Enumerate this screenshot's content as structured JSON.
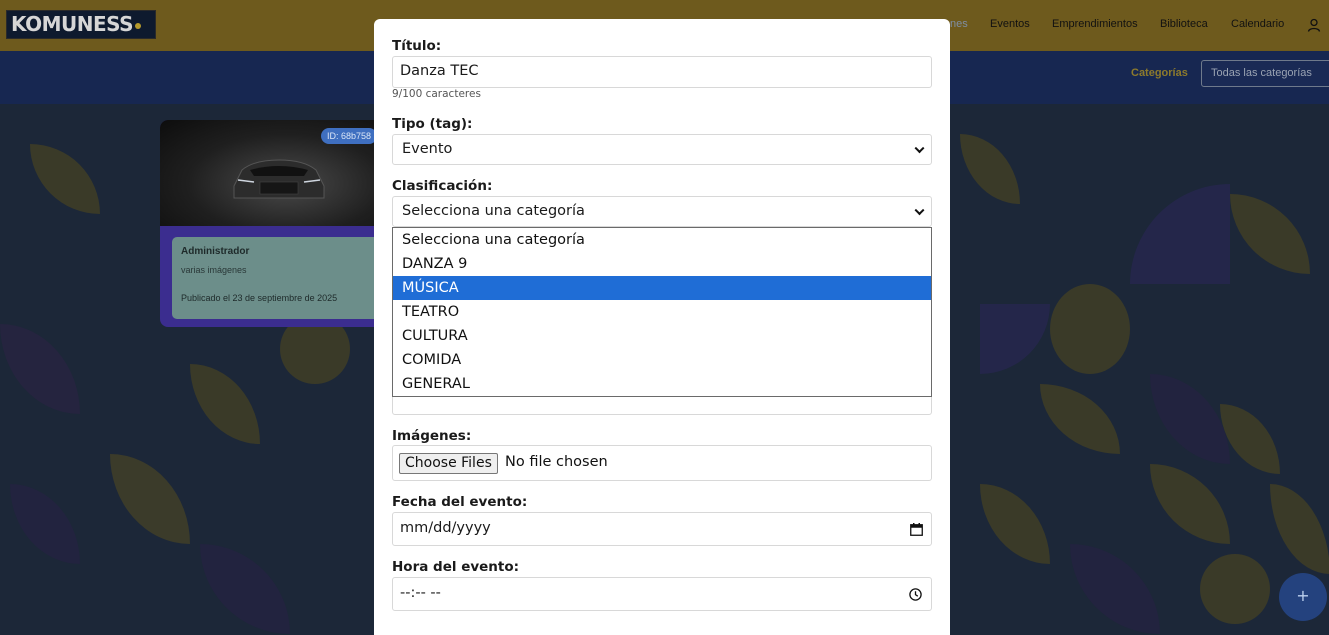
{
  "topbar": {
    "logo": "KOMUNESS",
    "nav": [
      "nes",
      "Eventos",
      "Emprendimientos",
      "Biblioteca",
      "Calendario"
    ]
  },
  "subbar": {
    "categories_label": "Categorías",
    "categories_value": "Todas las categorías"
  },
  "card": {
    "id": "ID: 68b758",
    "author": "Administrador",
    "description": "varias imágenes",
    "date": "Publicado el 23 de septiembre de 2025"
  },
  "form": {
    "title_label": "Título:",
    "title_value": "Danza TEC",
    "title_counter": "9/100 caracteres",
    "tag_label": "Tipo (tag):",
    "tag_value": "Evento",
    "class_label": "Clasificación:",
    "class_value": "Selecciona una categoría",
    "class_options": [
      "Selecciona una categoría",
      "DANZA 9",
      "MÚSICA",
      "TEATRO",
      "CULTURA",
      "COMIDA",
      "GENERAL"
    ],
    "class_highlighted": "MÚSICA",
    "images_label": "Imágenes:",
    "images_button": "Choose Files",
    "images_status": "No file chosen",
    "date_label": "Fecha del evento:",
    "date_placeholder": "mm/dd/yyyy",
    "time_label": "Hora del evento:",
    "time_placeholder": "--:-- --"
  },
  "fab": {
    "label": "+"
  },
  "colors": {
    "topbar": "#6e5a1d",
    "subbar": "#172751",
    "highlight": "#1f6dd6",
    "card": "#3b2d8f"
  }
}
